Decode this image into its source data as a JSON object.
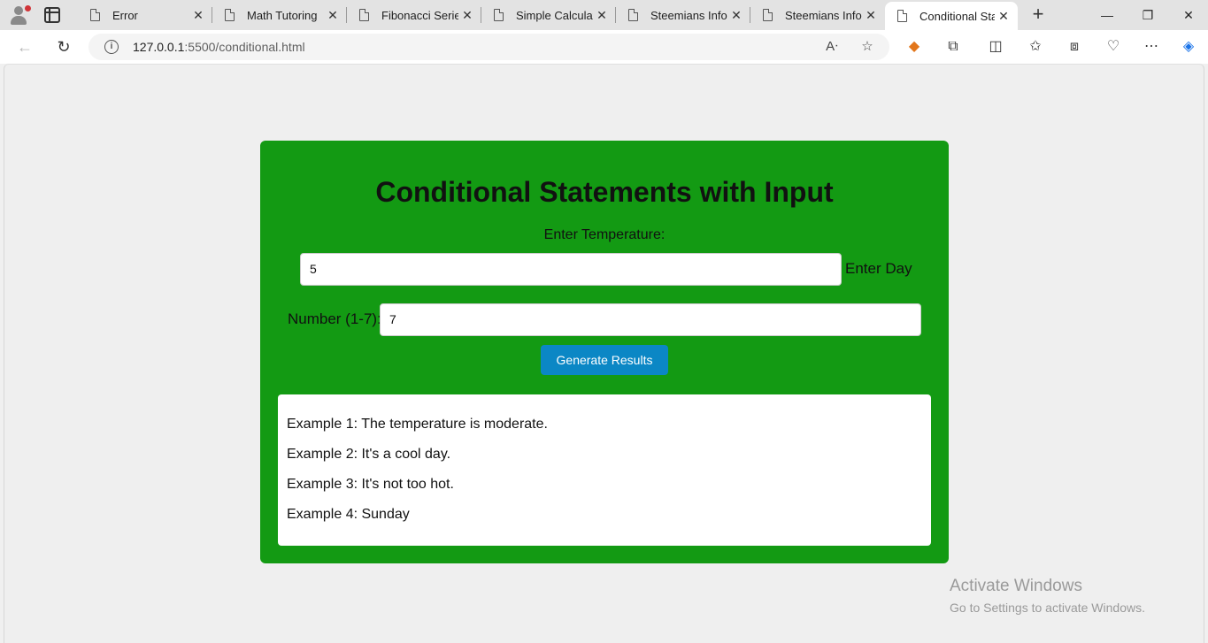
{
  "browser": {
    "tabs": [
      {
        "title": "Error"
      },
      {
        "title": "Math Tutoring"
      },
      {
        "title": "Fibonacci Series"
      },
      {
        "title": "Simple Calculato"
      },
      {
        "title": "Steemians Inform"
      },
      {
        "title": "Steemians Inform"
      },
      {
        "title": "Conditional Stat",
        "active": true
      }
    ],
    "new_tab_label": "+",
    "url_host": "127.0.0.1",
    "url_path": ":5500/conditional.html"
  },
  "page": {
    "heading": "Conditional Statements with Input",
    "temperature_label": "Enter Temperature:",
    "temperature_value": "5",
    "day_label_part1": "Enter Day",
    "day_label_part2": "Number (1-7):",
    "day_value": "7",
    "generate_button": "Generate Results",
    "results": [
      "Example 1: The temperature is moderate.",
      "Example 2: It's a cool day.",
      "Example 3: It's not too hot.",
      "Example 4: Sunday"
    ]
  },
  "watermark": {
    "line1": "Activate Windows",
    "line2": "Go to Settings to activate Windows."
  },
  "colors": {
    "card_bg": "#139a13",
    "button_bg": "#0b87c5"
  }
}
